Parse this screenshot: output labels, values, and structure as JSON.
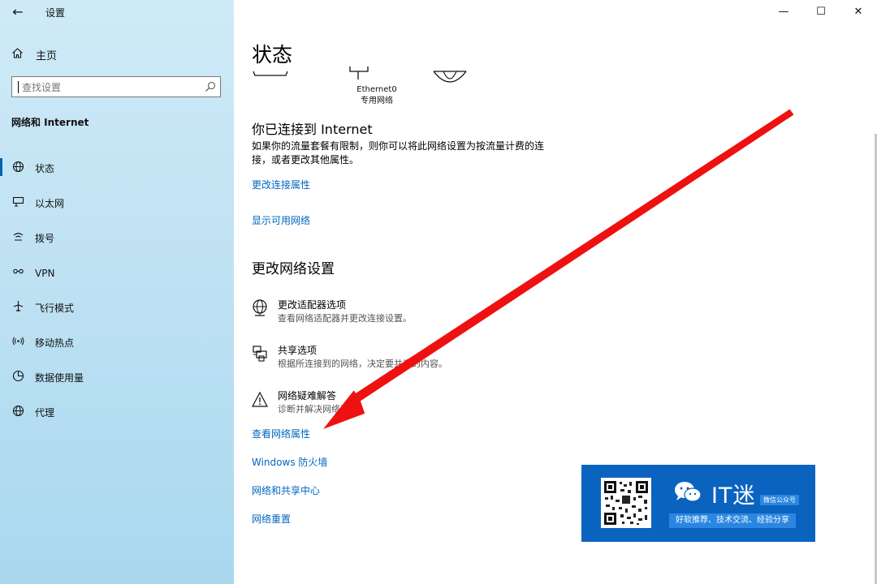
{
  "window": {
    "back_icon": "back-arrow-icon",
    "title": "设置",
    "controls": {
      "minimize": "—",
      "maximize": "☐",
      "close": "✕"
    }
  },
  "sidebar": {
    "home_label": "主页",
    "search_placeholder": "查找设置",
    "section_title": "网络和 Internet",
    "items": [
      {
        "label": "状态",
        "icon": "globe-status-icon",
        "active": true
      },
      {
        "label": "以太网",
        "icon": "ethernet-icon"
      },
      {
        "label": "拨号",
        "icon": "dialup-icon"
      },
      {
        "label": "VPN",
        "icon": "vpn-icon"
      },
      {
        "label": "飞行模式",
        "icon": "airplane-icon"
      },
      {
        "label": "移动热点",
        "icon": "hotspot-icon"
      },
      {
        "label": "数据使用量",
        "icon": "data-usage-icon"
      },
      {
        "label": "代理",
        "icon": "globe-icon"
      }
    ]
  },
  "main": {
    "page_title": "状态",
    "network_diagram": {
      "adapter_name": "Ethernet0",
      "network_type": "专用网络"
    },
    "connected_heading": "你已连接到 Internet",
    "connected_desc": "如果你的流量套餐有限制，则你可以将此网络设置为按流量计费的连接，或者更改其他属性。",
    "link_change_props": "更改连接属性",
    "link_show_networks": "显示可用网络",
    "change_heading": "更改网络设置",
    "options": [
      {
        "title": "更改适配器选项",
        "desc": "查看网络适配器并更改连接设置。",
        "icon": "adapter-globe-icon"
      },
      {
        "title": "共享选项",
        "desc": "根据所连接到的网络，决定要共享的内容。",
        "icon": "sharing-printer-icon"
      },
      {
        "title": "网络疑难解答",
        "desc": "诊断并解决网络问题。",
        "icon": "warning-triangle-icon"
      }
    ],
    "links": [
      "查看网络属性",
      "Windows 防火墙",
      "网络和共享中心",
      "网络重置"
    ]
  },
  "promo": {
    "brand": "IT迷",
    "badge": "微信公众号",
    "slogan": "好软推荐、技术交流、经验分享"
  },
  "colors": {
    "accent": "#0067c0",
    "arrow": "#ee1111",
    "promo_bg": "#0b63c0"
  }
}
